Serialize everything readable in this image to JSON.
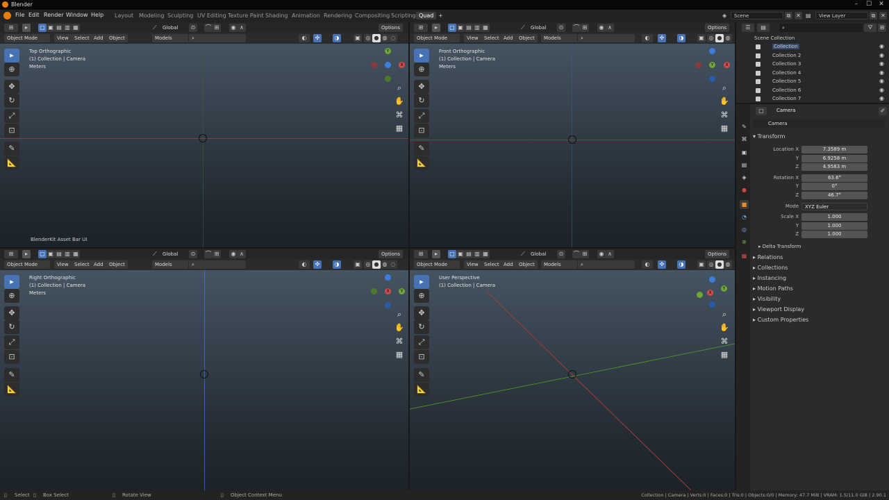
{
  "window": {
    "title": "Blender"
  },
  "menus": [
    "File",
    "Edit",
    "Render",
    "Window",
    "Help"
  ],
  "workspaces": [
    "Layout",
    "Modeling",
    "Sculpting",
    "UV Editing",
    "Texture Paint",
    "Shading",
    "Animation",
    "Rendering",
    "Compositing",
    "Scripting",
    "Quad"
  ],
  "active_workspace": "Quad",
  "scene": {
    "name": "Scene",
    "view_layer": "View Layer"
  },
  "viewport_header": {
    "mode": "Object Mode",
    "menus": [
      "View",
      "Select",
      "Add",
      "Object"
    ],
    "orientation": "Global",
    "options": "Options",
    "collection_filter": "Models"
  },
  "viewports": [
    {
      "name": "Top Orthographic",
      "collection": "(1) Collection | Camera",
      "units": "Meters"
    },
    {
      "name": "Front Orthographic",
      "collection": "(1) Collection | Camera",
      "units": "Meters"
    },
    {
      "name": "Right Orthographic",
      "collection": "(1) Collection | Camera",
      "units": "Meters"
    },
    {
      "name": "User Perspective",
      "collection": "(1) Collection | Camera",
      "units": ""
    }
  ],
  "asset_bar_label": "BlenderKit Asset Bar UI",
  "outliner": {
    "root": "Scene Collection",
    "items": [
      "Collection",
      "Collection 2",
      "Collection 3",
      "Collection 4",
      "Collection 5",
      "Collection 6",
      "Collection 7"
    ]
  },
  "properties": {
    "object_name": "Camera",
    "data_name": "Camera",
    "transform_label": "Transform",
    "location_label": "Location X",
    "rotation_label": "Rotation X",
    "scale_label": "Scale X",
    "y_label": "Y",
    "z_label": "Z",
    "mode_label": "Mode",
    "location": [
      "7.3589 m",
      "6.9258 m",
      "4.9583 m"
    ],
    "rotation": [
      "63.6°",
      "0°",
      "46.7°"
    ],
    "mode": "XYZ Euler",
    "scale": [
      "1.000",
      "1.000",
      "1.000"
    ],
    "delta_transform": "Delta Transform",
    "sections": [
      "Relations",
      "Collections",
      "Instancing",
      "Motion Paths",
      "Visibility",
      "Viewport Display",
      "Custom Properties"
    ]
  },
  "status": {
    "select": "Select",
    "box_select": "Box Select",
    "rotate_view": "Rotate View",
    "context_menu": "Object Context Menu",
    "stats": "Collection | Camera | Verts:0 | Faces:0 | Tris:0 | Objects:0/0 | Memory: 47.7 MiB | VRAM: 1.5/11.0 GiB | 2.90.1"
  },
  "colors": {
    "accent": "#4772b3",
    "x_axis": "#d24c4c",
    "y_axis": "#6fa832",
    "z_axis": "#3c7ee0"
  }
}
